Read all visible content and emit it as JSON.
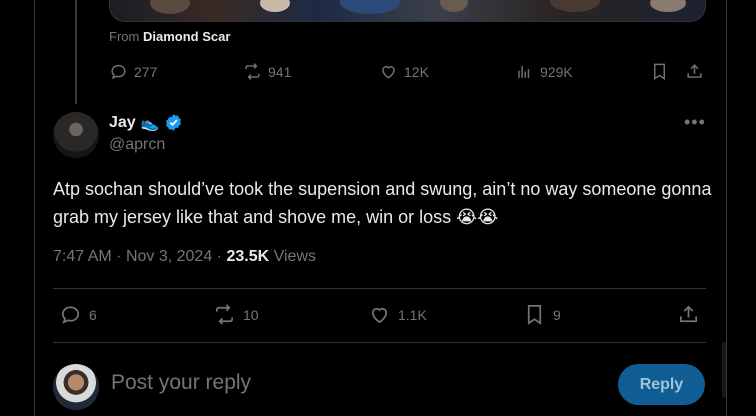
{
  "quoted": {
    "from_prefix": "From",
    "from_source": "Diamond Scar",
    "actions": {
      "replies": "277",
      "reposts": "941",
      "likes": "12K",
      "views": "929K"
    }
  },
  "tweet": {
    "author_name": "Jay",
    "author_emoji": "👟",
    "handle": "@aprcn",
    "text": "Atp sochan should’ve took the supension and swung, ain’t no way someone gonna grab my jersey like that and shove me, win or loss 😭😭",
    "time": "7:47 AM",
    "date": "Nov 3, 2024",
    "views_count": "23.5K",
    "views_label": "Views",
    "actions": {
      "replies": "6",
      "reposts": "10",
      "likes": "1.1K",
      "bookmarks": "9"
    }
  },
  "reply_box": {
    "placeholder": "Post your reply",
    "button_label": "Reply"
  },
  "colors": {
    "background": "#000000",
    "text_primary": "#e7e9ea",
    "text_secondary": "#71767b",
    "verified": "#1d9bf0",
    "reply_button": "#0f5d93"
  }
}
